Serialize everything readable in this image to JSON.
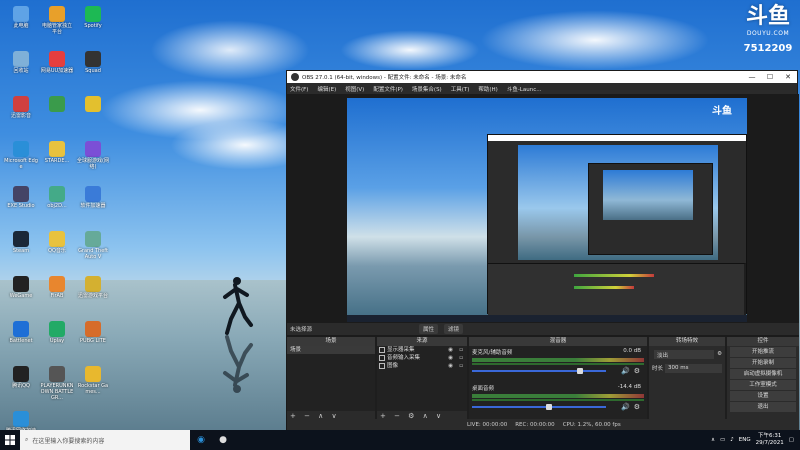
{
  "desktop": {
    "icons": [
      {
        "label": "此电脑",
        "color": "#5fa3e6"
      },
      {
        "label": "电脑管家独立平台",
        "color": "#e8a02a"
      },
      {
        "label": "Spotify",
        "color": "#1db954"
      },
      {
        "label": "回收站",
        "color": "#7fb0d8"
      },
      {
        "label": "网易UU加速器",
        "color": "#e53e3e"
      },
      {
        "label": "Squad",
        "color": "#333"
      },
      {
        "label": "迅雷影音",
        "color": "#d04040"
      },
      {
        "label": "",
        "color": "#3a9b4b"
      },
      {
        "label": "",
        "color": "#e3c02e"
      },
      {
        "label": "Microsoft Edge",
        "color": "#2a8fd8"
      },
      {
        "label": "STARDE...",
        "color": "#e8c23e"
      },
      {
        "label": "全球服游戏(网络)",
        "color": "#7b4fd6"
      },
      {
        "label": "EXE Studio",
        "color": "#446"
      },
      {
        "label": "obj2D...",
        "color": "#4a8"
      },
      {
        "label": "软件加速器",
        "color": "#3a7bd8"
      },
      {
        "label": "Steam",
        "color": "#1b2838"
      },
      {
        "label": "QQ音乐",
        "color": "#e8c23e"
      },
      {
        "label": "Grand Theft Auto V",
        "color": "#6a9"
      },
      {
        "label": "WeGame",
        "color": "#222"
      },
      {
        "label": "FirAB",
        "color": "#e8862e"
      },
      {
        "label": "迅雷游戏平台",
        "color": "#d4b030"
      },
      {
        "label": "Battlenet",
        "color": "#1e6fd6"
      },
      {
        "label": "Uplay",
        "color": "#2a6"
      },
      {
        "label": "PUBG LITE",
        "color": "#d66c2a"
      },
      {
        "label": "腾讯QQ",
        "color": "#222"
      },
      {
        "label": "PLAYERUNKNOWN BATTLEGR...",
        "color": "#555"
      },
      {
        "label": "Rockstar Games...",
        "color": "#e8b82e"
      },
      {
        "label": "腾讯网络加速器",
        "color": "#2a8fd8"
      }
    ]
  },
  "douyu": {
    "mark": "斗鱼",
    "sub": "DOUYU.COM",
    "room_id": "7512209"
  },
  "obs": {
    "title": "OBS 27.0.1 (64-bit, windows) - 配置文件: 未命名 - 场景: 未命名",
    "window_controls": {
      "minimize": "—",
      "maximize": "☐",
      "close": "✕"
    },
    "menu": [
      "文件(F)",
      "编辑(E)",
      "视图(V)",
      "配置文件(P)",
      "场景集合(S)",
      "工具(T)",
      "帮助(H)",
      "斗鱼-Launc..."
    ],
    "preview_douyu": "斗鱼",
    "scene_label": "未选择源",
    "scene_buttons": [
      "属性",
      "滤镜"
    ],
    "docks": {
      "scenes": {
        "title": "场景",
        "items": [
          "场景"
        ],
        "footer": "+ − ∧ ∨"
      },
      "sources": {
        "title": "来源",
        "items": [
          {
            "label": "显示器采集"
          },
          {
            "label": "音频输入采集"
          },
          {
            "label": "图像"
          }
        ],
        "footer": "+ − ⚙ ∧ ∨"
      },
      "mixer": {
        "title": "混音器",
        "channels": [
          {
            "name": "麦克风/辅助音频",
            "db": "0.0 dB",
            "level": 0.78
          },
          {
            "name": "桌面音频",
            "db": "-14.4 dB",
            "level": 0.55
          }
        ]
      },
      "transitions": {
        "title": "转场特效",
        "type": "淡出",
        "duration_label": "时长",
        "duration": "300 ms"
      },
      "controls": {
        "title": "控件",
        "buttons": [
          "开始推流",
          "开始录制",
          "启动虚拟摄像机",
          "工作室模式",
          "设置",
          "退出"
        ]
      }
    },
    "status": {
      "live": "LIVE: 00:00:00",
      "rec": "REC: 00:00:00",
      "cpu": "CPU: 1.2%, 60.00 fps"
    }
  },
  "taskbar": {
    "search_placeholder": "在这里输入你要搜索的内容",
    "tray_lang": "ENG",
    "time": "下午6:31",
    "date": "29/7/2021"
  }
}
